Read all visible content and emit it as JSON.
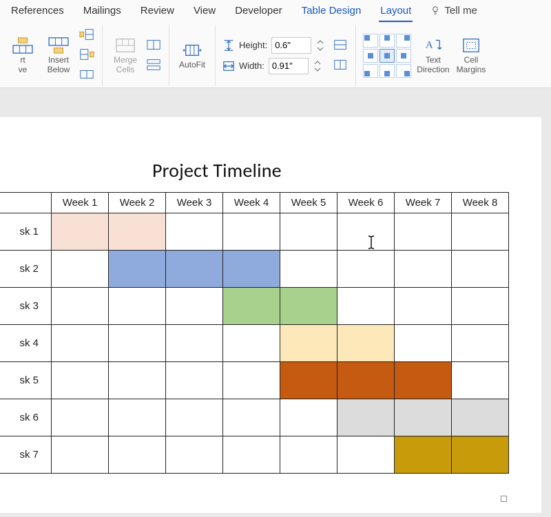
{
  "ribbon_tabs": {
    "references": "References",
    "mailings": "Mailings",
    "review": "Review",
    "view": "View",
    "developer": "Developer",
    "table_design": "Table Design",
    "layout": "Layout",
    "tell_me": "Tell me"
  },
  "ribbon": {
    "insert_above": "rt\nve",
    "insert_below": "Insert\nBelow",
    "merge_cells": "Merge\nCells",
    "autofit": "AutoFit",
    "height_label": "Height:",
    "height_value": "0.6\"",
    "width_label": "Width:",
    "width_value": "0.91\"",
    "text_direction": "Text\nDirection",
    "cell_margins": "Cell\nMargins"
  },
  "document": {
    "title": "Project Timeline",
    "columns": [
      "Week 1",
      "Week 2",
      "Week 3",
      "Week 4",
      "Week 5",
      "Week 6",
      "Week 7",
      "Week 8"
    ],
    "rows": [
      "sk 1",
      "sk 2",
      "sk 3",
      "sk 4",
      "sk 5",
      "sk 6",
      "sk 7"
    ]
  },
  "chart_data": {
    "type": "bar",
    "title": "Project Timeline",
    "categories": [
      "Week 1",
      "Week 2",
      "Week 3",
      "Week 4",
      "Week 5",
      "Week 6",
      "Week 7",
      "Week 8"
    ],
    "series": [
      {
        "name": "sk 1",
        "start": 1,
        "end": 2,
        "color": "#f9e0d5"
      },
      {
        "name": "sk 2",
        "start": 2,
        "end": 4,
        "color": "#8faadc"
      },
      {
        "name": "sk 3",
        "start": 4,
        "end": 5,
        "color": "#a9d18e"
      },
      {
        "name": "sk 4",
        "start": 5,
        "end": 6,
        "color": "#fce8b8"
      },
      {
        "name": "sk 5",
        "start": 5,
        "end": 7,
        "color": "#c55a11"
      },
      {
        "name": "sk 6",
        "start": 6,
        "end": 7,
        "color": "#dcdcdc",
        "extra": [
          8
        ]
      },
      {
        "name": "sk 7",
        "start": 7,
        "end": 8,
        "color": "#c89b0a"
      }
    ],
    "xlim": [
      1,
      8
    ]
  }
}
